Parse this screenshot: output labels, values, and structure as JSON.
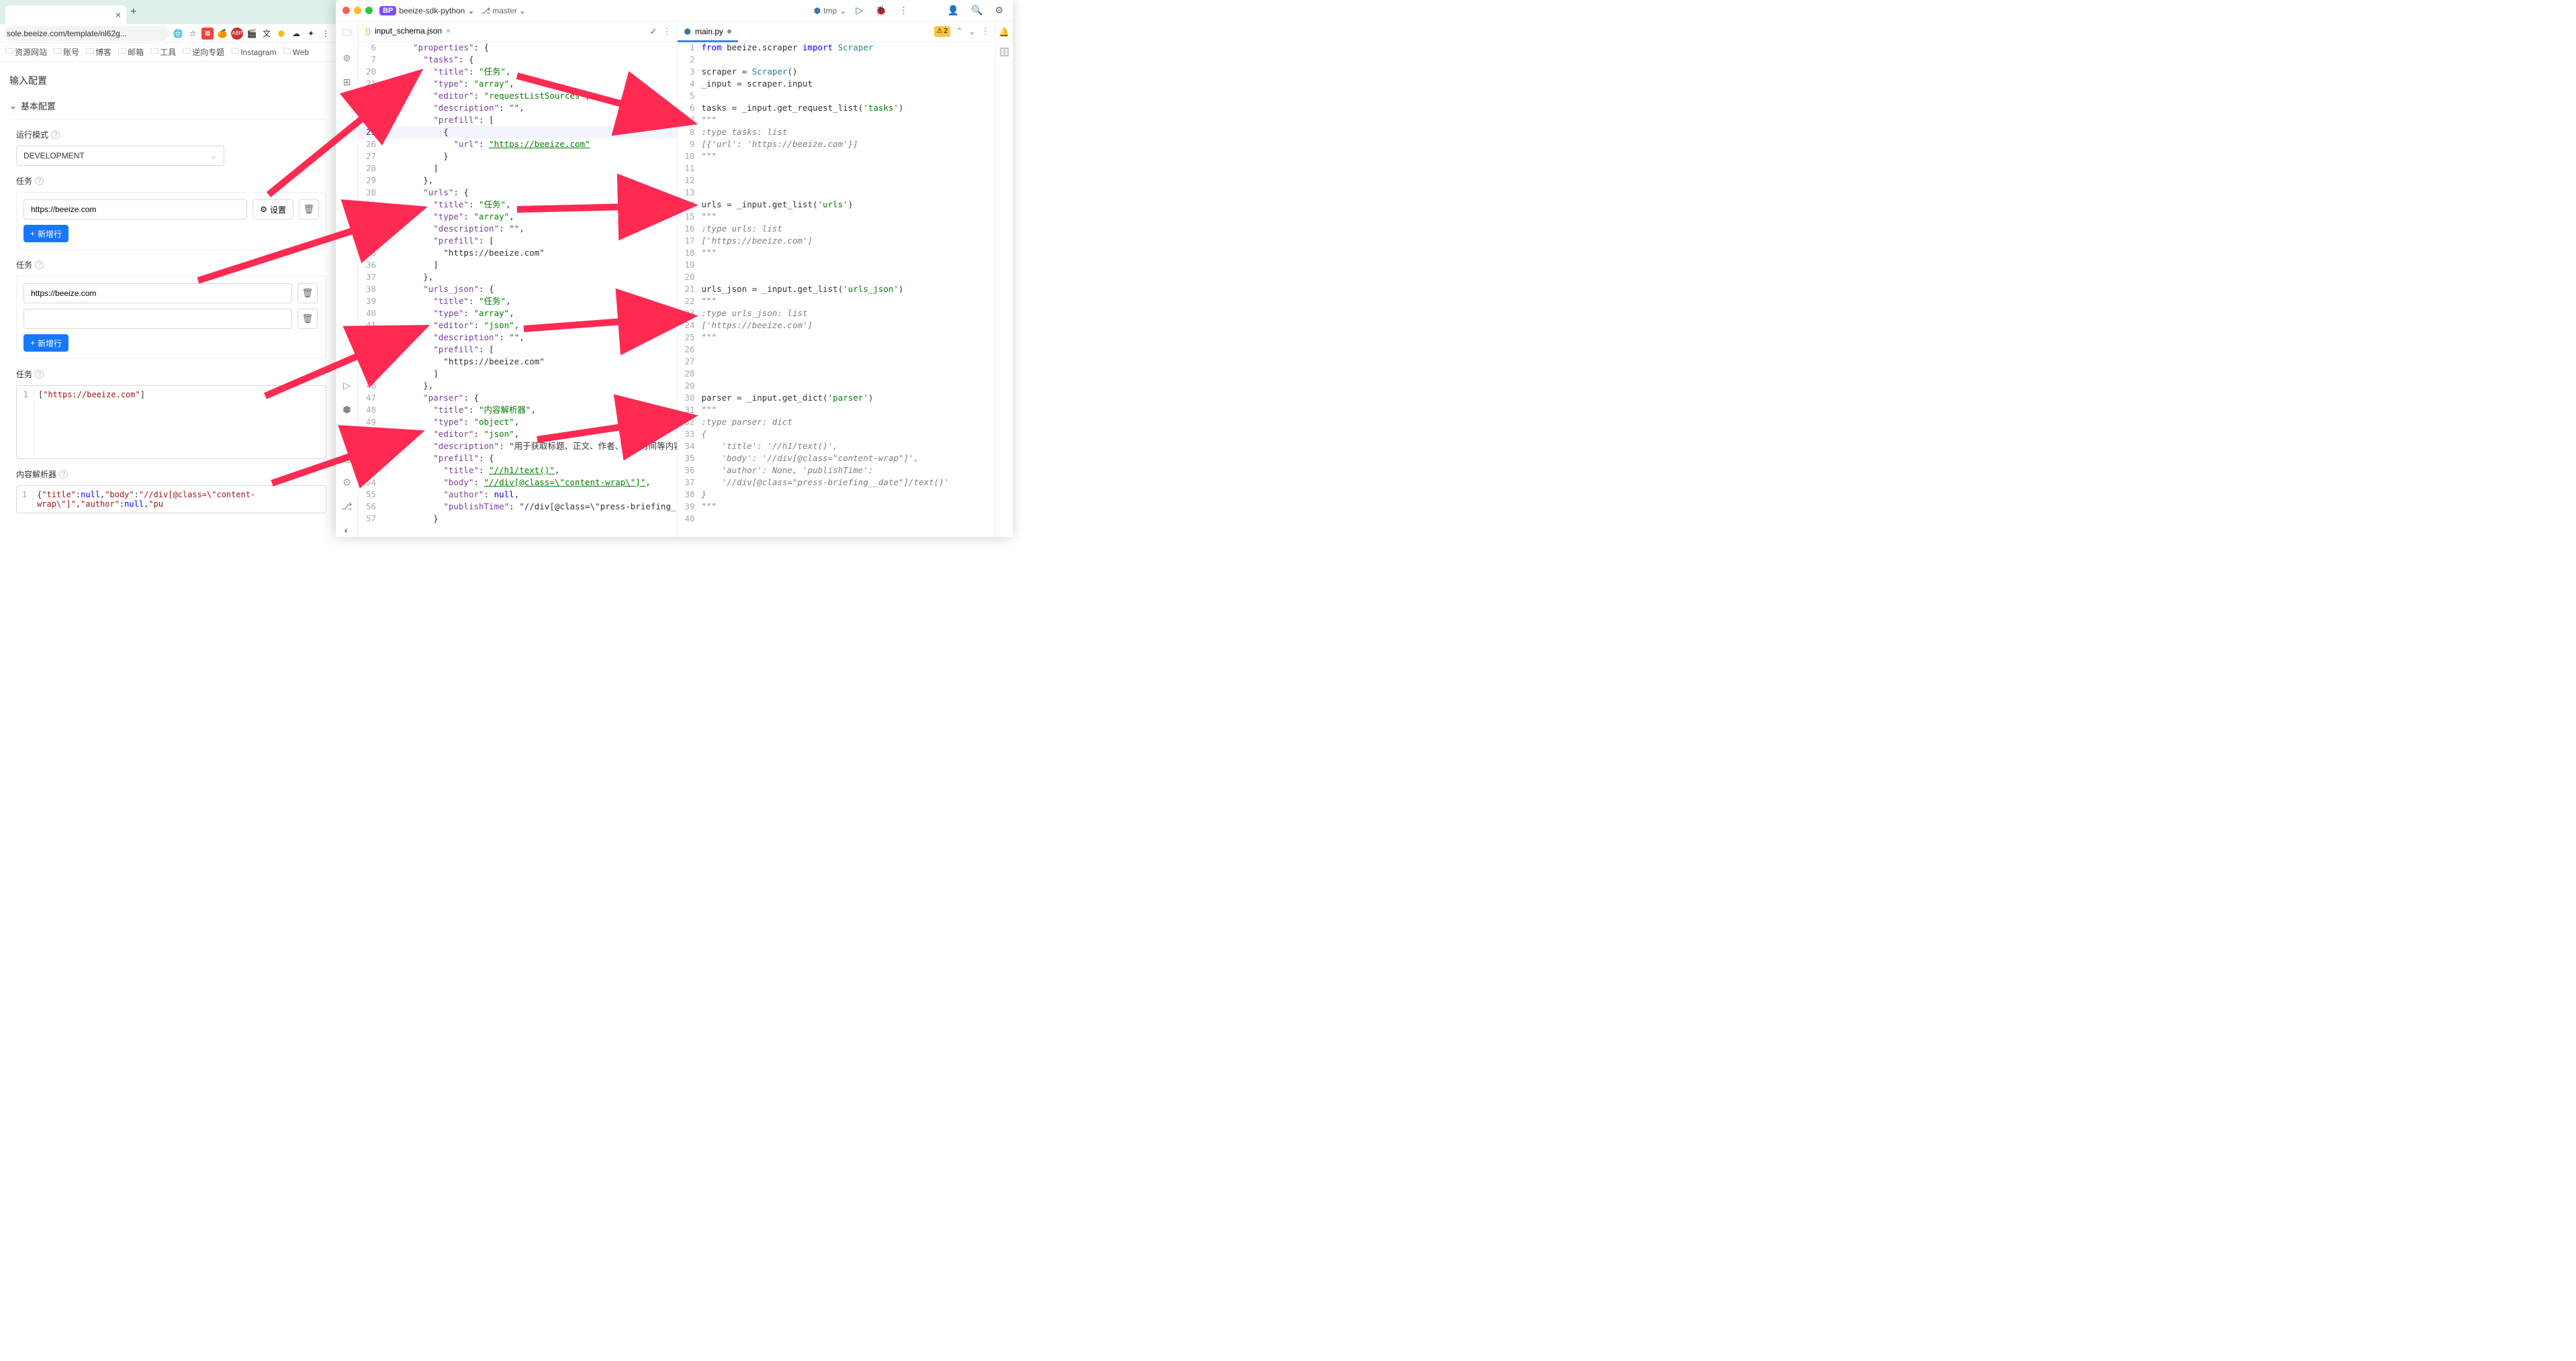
{
  "browser": {
    "tab_close": "×",
    "new_tab": "+",
    "address": "sole.beeize.com/template/nl62g...",
    "bookmarks": [
      "资源网站",
      "账号",
      "博客",
      "邮箱",
      "工具",
      "逆向专题",
      "Instagram",
      "Web"
    ],
    "addr_icons": {
      "translate": "🌐",
      "star": "☆"
    }
  },
  "page": {
    "header": "输入配置",
    "basic_config": "基本配置",
    "run_mode_label": "运行模式",
    "run_mode_value": "DEVELOPMENT",
    "task_label": "任务",
    "task1_value": "https://beeize.com",
    "settings_btn": "设置",
    "add_row_btn": "新增行",
    "task2_value": "https://beeize.com",
    "task3_json": "[\"https://beeize.com\"]",
    "parser_label": "内容解析器",
    "parser_json_prefix": "{\"title\":null,\"body\":\"//div[@class=\\\"content-wrap\\\"]\",\"author\":null,\"pu"
  },
  "ide": {
    "project": "beeize-sdk-python",
    "project_badge": "BP",
    "branch": "master",
    "interp": "tmp",
    "left_tab": "input_schema.json",
    "right_tab": "main.py",
    "warnings": "2",
    "left_lines": [
      {
        "n": 6,
        "t": "      \"properties\": {"
      },
      {
        "n": 7,
        "t": "        \"tasks\": {"
      },
      {
        "n": 20,
        "t": "          \"title\": \"任务\","
      },
      {
        "n": 21,
        "t": "          \"type\": \"array\","
      },
      {
        "n": 22,
        "t": "          \"editor\": \"requestListSources\","
      },
      {
        "n": 23,
        "t": "          \"description\": \"\","
      },
      {
        "n": 24,
        "t": "          \"prefill\": ["
      },
      {
        "n": 25,
        "t": "            {",
        "hl": true
      },
      {
        "n": 26,
        "t": "              \"url\": \"https://beeize.com\""
      },
      {
        "n": 27,
        "t": "            }"
      },
      {
        "n": 28,
        "t": "          ]"
      },
      {
        "n": 29,
        "t": "        },"
      },
      {
        "n": 30,
        "t": "        \"urls\": {"
      },
      {
        "n": 31,
        "t": "          \"title\": \"任务\","
      },
      {
        "n": 32,
        "t": "          \"type\": \"array\","
      },
      {
        "n": 33,
        "t": "          \"description\": \"\","
      },
      {
        "n": 34,
        "t": "          \"prefill\": ["
      },
      {
        "n": 35,
        "t": "            \"https://beeize.com\""
      },
      {
        "n": 36,
        "t": "          ]"
      },
      {
        "n": 37,
        "t": "        },"
      },
      {
        "n": 38,
        "t": "        \"urls_json\": {"
      },
      {
        "n": 39,
        "t": "          \"title\": \"任务\","
      },
      {
        "n": 40,
        "t": "          \"type\": \"array\","
      },
      {
        "n": 41,
        "t": "          \"editor\": \"json\","
      },
      {
        "n": 42,
        "t": "          \"description\": \"\","
      },
      {
        "n": 43,
        "t": "          \"prefill\": ["
      },
      {
        "n": 44,
        "t": "            \"https://beeize.com\""
      },
      {
        "n": 45,
        "t": "          ]"
      },
      {
        "n": 46,
        "t": "        },"
      },
      {
        "n": 47,
        "t": "        \"parser\": {"
      },
      {
        "n": 48,
        "t": "          \"title\": \"内容解析器\","
      },
      {
        "n": 49,
        "t": "          \"type\": \"object\","
      },
      {
        "n": 50,
        "t": "          \"editor\": \"json\","
      },
      {
        "n": 51,
        "t": "          \"description\": \"用于获取标题、正文、作者、发布时间等内容"
      },
      {
        "n": 52,
        "t": "          \"prefill\": {"
      },
      {
        "n": 53,
        "t": "            \"title\": \"//h1/text()\","
      },
      {
        "n": 54,
        "t": "            \"body\": \"//div[@class=\\\"content-wrap\\\"]\","
      },
      {
        "n": 55,
        "t": "            \"author\": null,"
      },
      {
        "n": 56,
        "t": "            \"publishTime\": \"//div[@class=\\\"press-briefing_"
      },
      {
        "n": 57,
        "t": "          }"
      }
    ],
    "right_lines": [
      {
        "n": 1,
        "t": "from beeize.scraper import Scraper"
      },
      {
        "n": 2,
        "t": ""
      },
      {
        "n": 3,
        "t": "scraper = Scraper()"
      },
      {
        "n": 4,
        "t": "_input = scraper.input"
      },
      {
        "n": 5,
        "t": ""
      },
      {
        "n": 6,
        "t": "tasks = _input.get_request_list('tasks')"
      },
      {
        "n": 7,
        "t": "\"\"\""
      },
      {
        "n": 8,
        "t": ":type tasks: list"
      },
      {
        "n": 9,
        "t": "[{'url': 'https://beeize.com'}]"
      },
      {
        "n": 10,
        "t": "\"\"\""
      },
      {
        "n": 11,
        "t": ""
      },
      {
        "n": 12,
        "t": ""
      },
      {
        "n": 13,
        "t": ""
      },
      {
        "n": 14,
        "t": "urls = _input.get_list('urls')"
      },
      {
        "n": 15,
        "t": "\"\"\""
      },
      {
        "n": 16,
        "t": ":type urls: list"
      },
      {
        "n": 17,
        "t": "['https://beeize.com']"
      },
      {
        "n": 18,
        "t": "\"\"\""
      },
      {
        "n": 19,
        "t": ""
      },
      {
        "n": 20,
        "t": ""
      },
      {
        "n": 21,
        "t": "urls_json = _input.get_list('urls_json')"
      },
      {
        "n": 22,
        "t": "\"\"\""
      },
      {
        "n": 23,
        "t": ":type urls_json: list"
      },
      {
        "n": 24,
        "t": "['https://beeize.com']"
      },
      {
        "n": 25,
        "t": "\"\"\""
      },
      {
        "n": 26,
        "t": ""
      },
      {
        "n": 27,
        "t": ""
      },
      {
        "n": 28,
        "t": ""
      },
      {
        "n": 29,
        "t": ""
      },
      {
        "n": 30,
        "t": "parser = _input.get_dict('parser')"
      },
      {
        "n": 31,
        "t": "\"\"\""
      },
      {
        "n": 32,
        "t": ":type parser: dict"
      },
      {
        "n": 33,
        "t": "{"
      },
      {
        "n": 34,
        "t": "    'title': '//h1/text()',"
      },
      {
        "n": 35,
        "t": "    'body': '//div[@class=\"content-wrap\"]',"
      },
      {
        "n": 36,
        "t": "    'author': None, 'publishTime':"
      },
      {
        "n": 37,
        "t": "    '//div[@class=\"press-briefing__date\"]/text()'"
      },
      {
        "n": 38,
        "t": "}"
      },
      {
        "n": 39,
        "t": "\"\"\""
      },
      {
        "n": 40,
        "t": ""
      }
    ]
  }
}
